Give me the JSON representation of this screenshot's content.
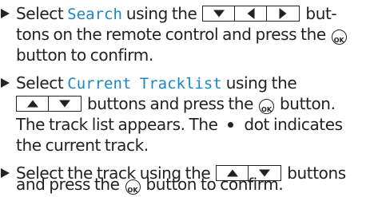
{
  "steps": [
    {
      "lines": [
        {
          "pre": "Select ",
          "highlight": "Search",
          "mid": " using the ",
          "post": " but-"
        },
        {
          "text": "tons on the remote control and press the ",
          "post": ""
        },
        {
          "text": "button to confirm."
        }
      ]
    },
    {
      "lines": [
        {
          "pre": "Select ",
          "highlight": "Current Tracklist",
          "post": " using the"
        },
        {
          "post": " buttons and press the ",
          "post2": " button."
        },
        {
          "text": "The track list appears. The ",
          "post": " dot indicates"
        },
        {
          "text": "the current track."
        }
      ]
    },
    {
      "lines": [
        {
          "pre": "Select the track using the ",
          "post": " buttons"
        },
        {
          "pre": "and press the ",
          "post": " button to confirm."
        }
      ]
    }
  ],
  "ok_label": "OK",
  "icons": {
    "bullet": "triangle-bullet-icon",
    "down": "arrow-down-icon",
    "up": "arrow-up-icon",
    "left": "arrow-left-icon",
    "right": "arrow-right-icon",
    "ok": "ok-button-icon",
    "dot": "current-track-dot-icon"
  },
  "colors": {
    "text": "#222222",
    "highlight": "#1a88c8"
  }
}
